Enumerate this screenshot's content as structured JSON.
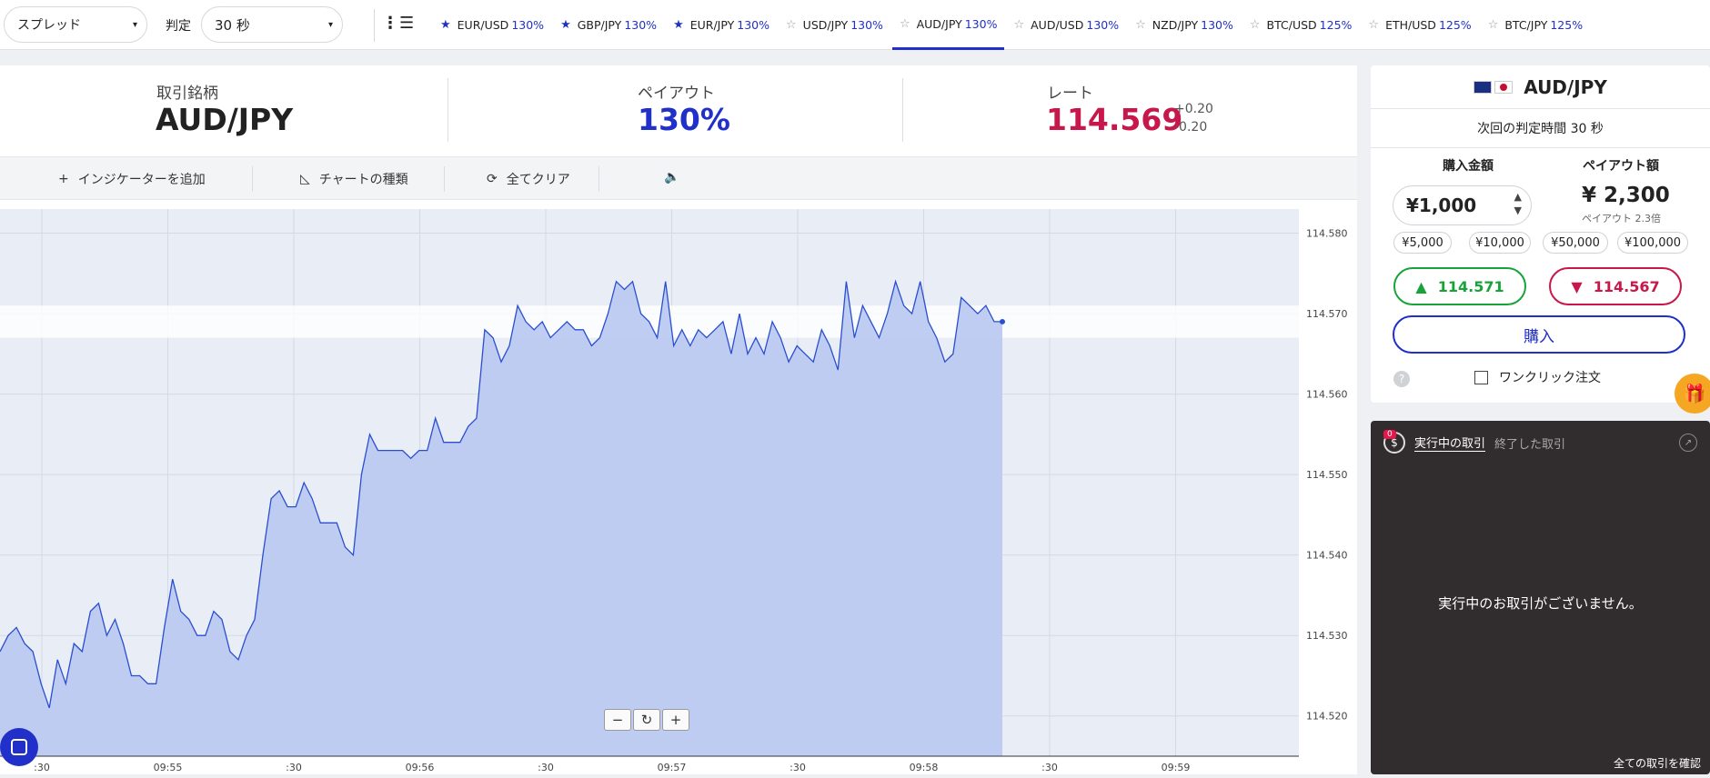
{
  "topbar": {
    "spread_label": "スプレッド",
    "judge_label": "判定",
    "judge_value": "30 秒",
    "tabs": [
      {
        "pair": "EUR/USD",
        "payout": "130%",
        "starred": true,
        "active": false
      },
      {
        "pair": "GBP/JPY",
        "payout": "130%",
        "starred": true,
        "active": false
      },
      {
        "pair": "EUR/JPY",
        "payout": "130%",
        "starred": true,
        "active": false
      },
      {
        "pair": "USD/JPY",
        "payout": "130%",
        "starred": false,
        "active": false
      },
      {
        "pair": "AUD/JPY",
        "payout": "130%",
        "starred": false,
        "active": true
      },
      {
        "pair": "AUD/USD",
        "payout": "130%",
        "starred": false,
        "active": false
      },
      {
        "pair": "NZD/JPY",
        "payout": "130%",
        "starred": false,
        "active": false
      },
      {
        "pair": "BTC/USD",
        "payout": "125%",
        "starred": false,
        "active": false
      },
      {
        "pair": "ETH/USD",
        "payout": "125%",
        "starred": false,
        "active": false
      },
      {
        "pair": "BTC/JPY",
        "payout": "125%",
        "starred": false,
        "active": false
      }
    ]
  },
  "info": {
    "symbol_label": "取引銘柄",
    "symbol": "AUD/JPY",
    "payout_label": "ペイアウト",
    "payout": "130%",
    "rate_label": "レート",
    "rate": "114.569",
    "diff_up": "+0.20",
    "diff_down": "-0.20"
  },
  "toolbar": {
    "add_indicator": "インジケーターを追加",
    "chart_type": "チャートの種類",
    "clear_all": "全てクリア"
  },
  "chart_data": {
    "type": "area",
    "title": "",
    "xlabel": "",
    "ylabel": "",
    "y_ticks": [
      "114.580",
      "114.570",
      "114.560",
      "114.550",
      "114.540",
      "114.530",
      "114.520"
    ],
    "x_ticks": [
      ":30",
      "09:55",
      ":30",
      "09:56",
      ":30",
      "09:57",
      ":30",
      "09:58",
      ":30",
      "09:59"
    ],
    "ylim": [
      114.515,
      114.583
    ],
    "series": [
      {
        "values": [
          114.528,
          114.53,
          114.531,
          114.529,
          114.528,
          114.524,
          114.521,
          114.527,
          114.524,
          114.529,
          114.528,
          114.533,
          114.534,
          114.53,
          114.532,
          114.529,
          114.525,
          114.525,
          114.524,
          114.524,
          114.531,
          114.537,
          114.533,
          114.532,
          114.53,
          114.53,
          114.533,
          114.532,
          114.528,
          114.527,
          114.53,
          114.532,
          114.54,
          114.547,
          114.548,
          114.546,
          114.546,
          114.549,
          114.547,
          114.544,
          114.544,
          114.544,
          114.541,
          114.54,
          114.55,
          114.555,
          114.553,
          114.553,
          114.553,
          114.553,
          114.552,
          114.553,
          114.553,
          114.557,
          114.554,
          114.554,
          114.554,
          114.556,
          114.557,
          114.568,
          114.567,
          114.564,
          114.566,
          114.571,
          114.569,
          114.568,
          114.569,
          114.567,
          114.568,
          114.569,
          114.568,
          114.568,
          114.566,
          114.567,
          114.57,
          114.574,
          114.573,
          114.574,
          114.57,
          114.569,
          114.567,
          114.574,
          114.566,
          114.568,
          114.566,
          114.568,
          114.567,
          114.568,
          114.569,
          114.565,
          114.57,
          114.565,
          114.567,
          114.565,
          114.569,
          114.567,
          114.564,
          114.566,
          114.565,
          114.564,
          114.568,
          114.566,
          114.563,
          114.574,
          114.567,
          114.571,
          114.569,
          114.567,
          114.57,
          114.574,
          114.571,
          114.57,
          114.574,
          114.569,
          114.567,
          114.564,
          114.565,
          114.572,
          114.571,
          114.57,
          114.571,
          114.569,
          114.569
        ],
        "color": "#2a4ed0",
        "fill": "#bccaf1"
      }
    ],
    "current_band": [
      114.567,
      114.571
    ]
  },
  "right": {
    "pair": "AUD/JPY",
    "next_judge": "次回の判定時間 30 秒",
    "amount_label": "購入金額",
    "payout_label": "ペイアウト額",
    "amount": "¥1,000",
    "payout_amount": "¥ 2,300",
    "payout_mult": "ペイアウト 2.3倍",
    "presets": [
      "¥5,000",
      "¥10,000",
      "¥50,000",
      "¥100,000"
    ],
    "high_price": "114.571",
    "low_price": "114.567",
    "buy": "購入",
    "oneclick": "ワンクリック注文",
    "trades_badge": "0",
    "tab_active": "実行中の取引",
    "tab_inactive": "終了した取引",
    "empty_msg": "実行中のお取引がございません。",
    "confirm_all": "全ての取引を確認"
  },
  "colors": {
    "accent": "#2030c8",
    "up": "#18a33a",
    "down": "#c8174a"
  }
}
